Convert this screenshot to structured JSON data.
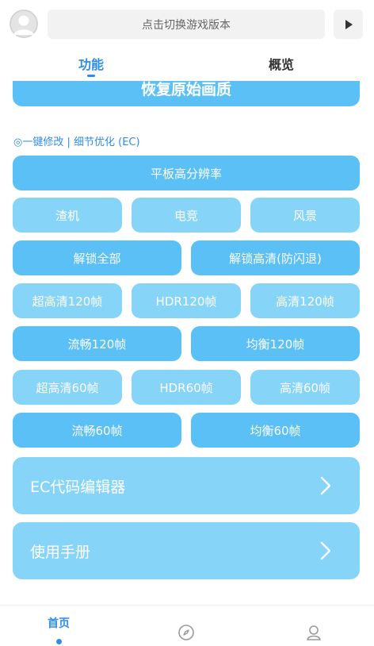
{
  "header": {
    "version_switch": "点击切换游戏版本"
  },
  "tabs": [
    {
      "label": "功能",
      "active": true
    },
    {
      "label": "概览",
      "active": false
    }
  ],
  "restore_button": "恢复原始画质",
  "section": {
    "label": "◎一键修改 | 细节优化 (EC)"
  },
  "buttons": {
    "tablet_resolution": "平板高分辨率",
    "row_style": [
      "渣机",
      "电竞",
      "风景"
    ],
    "row_unlock": [
      "解锁全部",
      "解锁高清(防闪退)"
    ],
    "row_120_a": [
      "超高清120帧",
      "HDR120帧",
      "高清120帧"
    ],
    "row_120_b": [
      "流畅120帧",
      "均衡120帧"
    ],
    "row_60_a": [
      "超高清60帧",
      "HDR60帧",
      "高清60帧"
    ],
    "row_60_b": [
      "流畅60帧",
      "均衡60帧"
    ]
  },
  "cards": {
    "ec_editor": "EC代码编辑器",
    "manual": "使用手册"
  },
  "bottom_nav": {
    "home": "首页"
  },
  "colors": {
    "accent": "#2f8ee8",
    "button_dark": "#5bc0f5",
    "button_light": "#86d4f8"
  },
  "icons": [
    "avatar-icon",
    "play-icon",
    "chevron-right-icon",
    "compass-icon",
    "user-icon"
  ]
}
